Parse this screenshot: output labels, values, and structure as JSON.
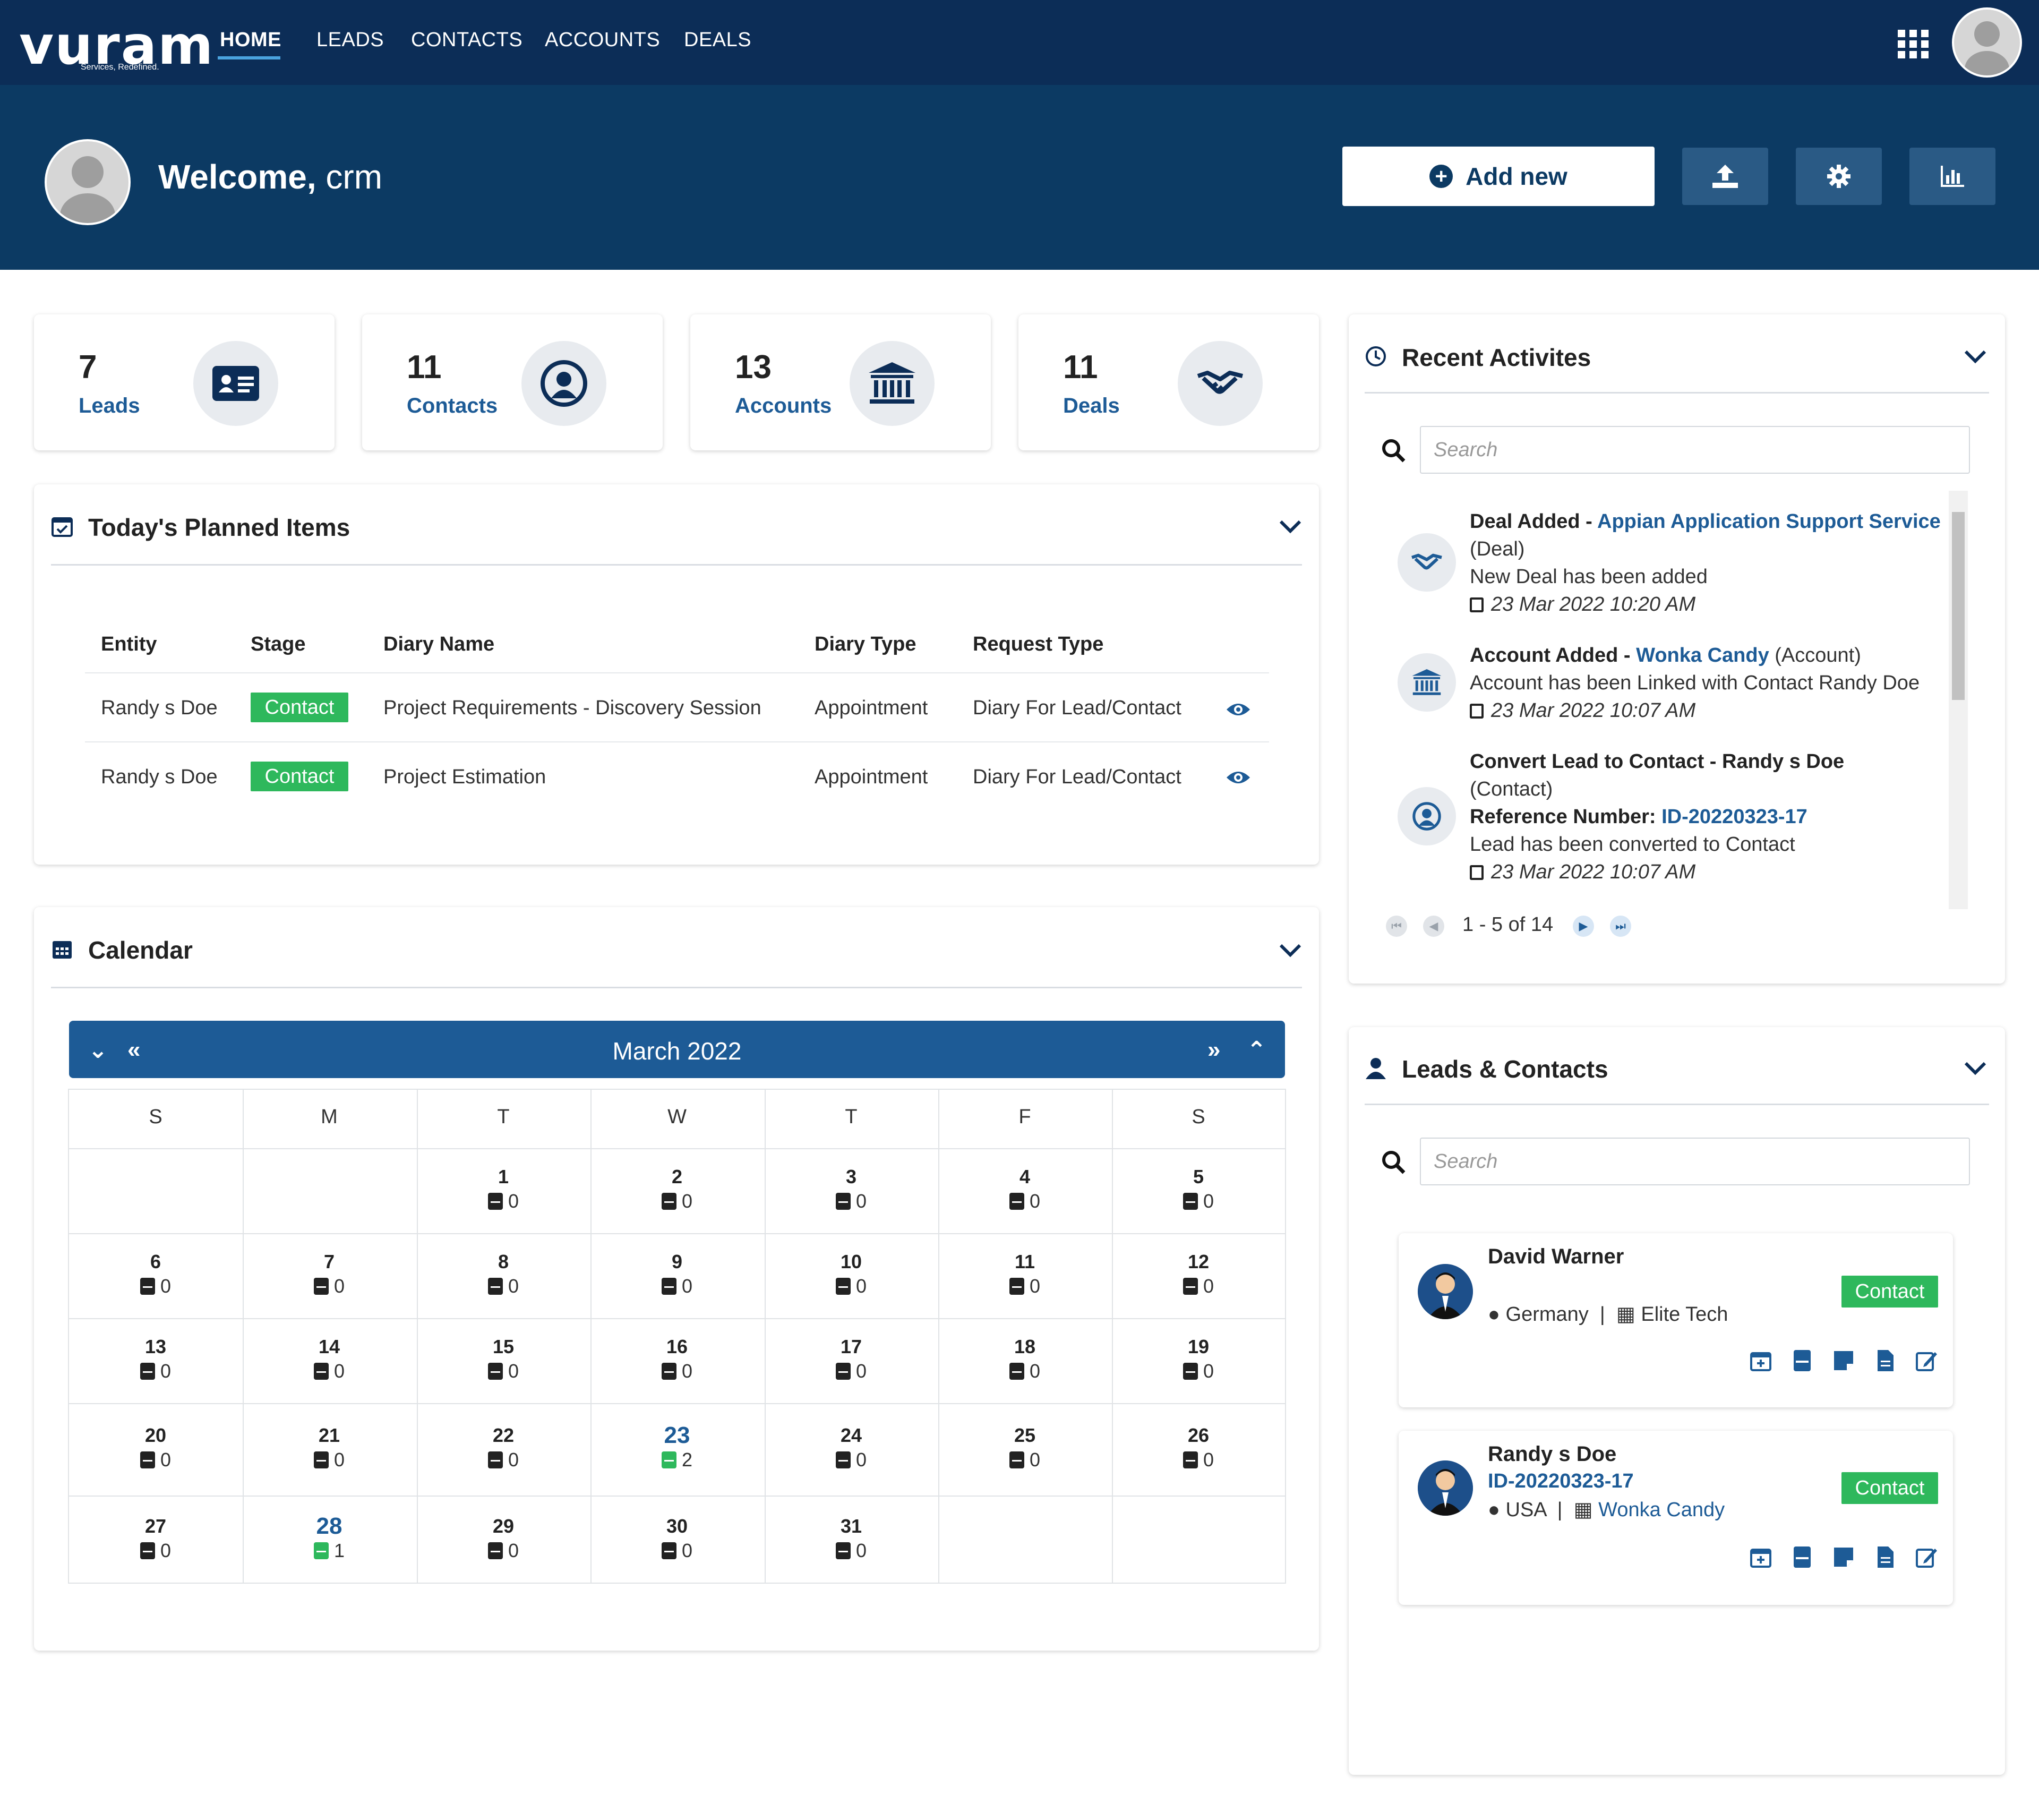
{
  "nav": {
    "logo": "vuram",
    "logo_tagline": "Services, Redefined.",
    "links": [
      "HOME",
      "LEADS",
      "CONTACTS",
      "ACCOUNTS",
      "DEALS"
    ],
    "active": "HOME"
  },
  "header": {
    "welcome_prefix": "Welcome,",
    "user": "crm",
    "add_new_label": "Add new",
    "icons": [
      "upload-icon",
      "gear-icon",
      "chart-icon"
    ]
  },
  "stats": [
    {
      "value": "7",
      "label": "Leads",
      "icon": "id-card-icon"
    },
    {
      "value": "11",
      "label": "Contacts",
      "icon": "user-circle-icon"
    },
    {
      "value": "13",
      "label": "Accounts",
      "icon": "bank-icon"
    },
    {
      "value": "11",
      "label": "Deals",
      "icon": "handshake-icon"
    }
  ],
  "planned": {
    "title": "Today's Planned Items",
    "columns": [
      "Entity",
      "Stage",
      "Diary Name",
      "Diary Type",
      "Request Type"
    ],
    "rows": [
      {
        "entity": "Randy s Doe",
        "stage": "Contact",
        "diary_name": "Project Requirements - Discovery Session",
        "diary_type": "Appointment",
        "request_type": "Diary For Lead/Contact"
      },
      {
        "entity": "Randy s Doe",
        "stage": "Contact",
        "diary_name": "Project Estimation",
        "diary_type": "Appointment",
        "request_type": "Diary For Lead/Contact"
      }
    ]
  },
  "calendar": {
    "title": "Calendar",
    "month": "March 2022",
    "dow": [
      "S",
      "M",
      "T",
      "W",
      "T",
      "F",
      "S"
    ],
    "weeks": [
      [
        null,
        null,
        {
          "d": "1",
          "c": "0"
        },
        {
          "d": "2",
          "c": "0"
        },
        {
          "d": "3",
          "c": "0"
        },
        {
          "d": "4",
          "c": "0"
        },
        {
          "d": "5",
          "c": "0"
        }
      ],
      [
        {
          "d": "6",
          "c": "0"
        },
        {
          "d": "7",
          "c": "0"
        },
        {
          "d": "8",
          "c": "0"
        },
        {
          "d": "9",
          "c": "0"
        },
        {
          "d": "10",
          "c": "0"
        },
        {
          "d": "11",
          "c": "0"
        },
        {
          "d": "12",
          "c": "0"
        }
      ],
      [
        {
          "d": "13",
          "c": "0"
        },
        {
          "d": "14",
          "c": "0"
        },
        {
          "d": "15",
          "c": "0"
        },
        {
          "d": "16",
          "c": "0"
        },
        {
          "d": "17",
          "c": "0"
        },
        {
          "d": "18",
          "c": "0"
        },
        {
          "d": "19",
          "c": "0"
        }
      ],
      [
        {
          "d": "20",
          "c": "0"
        },
        {
          "d": "21",
          "c": "0"
        },
        {
          "d": "22",
          "c": "0"
        },
        {
          "d": "23",
          "c": "2",
          "hl": true
        },
        {
          "d": "24",
          "c": "0"
        },
        {
          "d": "25",
          "c": "0"
        },
        {
          "d": "26",
          "c": "0"
        }
      ],
      [
        {
          "d": "27",
          "c": "0"
        },
        {
          "d": "28",
          "c": "1",
          "hl": true
        },
        {
          "d": "29",
          "c": "0"
        },
        {
          "d": "30",
          "c": "0"
        },
        {
          "d": "31",
          "c": "0"
        },
        null,
        null
      ]
    ]
  },
  "activities": {
    "title": "Recent Activites",
    "search_placeholder": "Search",
    "items": [
      {
        "icon": "handshake-icon",
        "heading": "Deal Added - ",
        "link": "Appian Application Support Service",
        "type": " (Deal)",
        "ref_label": "",
        "ref_value": "",
        "desc": "New Deal has been added",
        "date": "23 Mar 2022 10:20 AM"
      },
      {
        "icon": "bank-icon",
        "heading": "Account Added - ",
        "link": "Wonka Candy",
        "type": " (Account)",
        "ref_label": "",
        "ref_value": "",
        "desc": "Account has been Linked with Contact Randy Doe",
        "date": "23 Mar 2022 10:07 AM"
      },
      {
        "icon": "user-circle-icon",
        "heading": "Convert Lead to Contact - Randy s Doe",
        "link": "",
        "type": "(Contact)",
        "ref_label": "Reference Number: ",
        "ref_value": "ID-20220323-17",
        "desc": "Lead has been converted to Contact",
        "date": "23 Mar 2022 10:07 AM"
      }
    ],
    "pager_text": "1 - 5 of 14"
  },
  "leads_contacts": {
    "title": "Leads & Contacts",
    "search_placeholder": "Search",
    "cards": [
      {
        "name": "David Warner",
        "ref": "",
        "country": "Germany",
        "company": "Elite Tech",
        "badge": "Contact"
      },
      {
        "name": "Randy s Doe",
        "ref": "ID-20220323-17",
        "country": "USA",
        "company": "Wonka Candy",
        "badge": "Contact"
      }
    ]
  },
  "colors": {
    "navy": "#0c2d57",
    "header": "#0c3a63",
    "accent": "#1d5b96",
    "green": "#2eb85c"
  }
}
